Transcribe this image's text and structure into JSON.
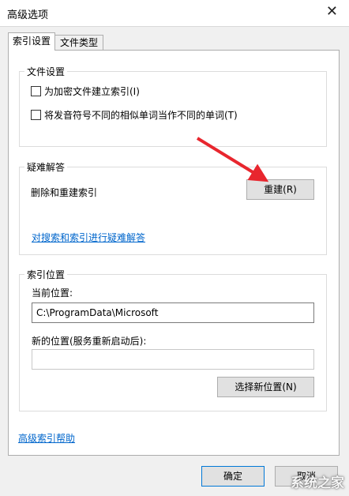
{
  "window": {
    "title": "高级选项",
    "close_glyph": "✕"
  },
  "tabs": [
    {
      "label": "索引设置",
      "active": true
    },
    {
      "label": "文件类型",
      "active": false
    }
  ],
  "file_settings": {
    "title": "文件设置",
    "options": [
      {
        "label": "为加密文件建立索引(I)",
        "checked": false
      },
      {
        "label": "将发音符号不同的相似单词当作不同的单词(T)",
        "checked": false
      }
    ]
  },
  "troubleshooting": {
    "title": "疑难解答",
    "rebuild_label": "删除和重建索引",
    "rebuild_button": "重建(R)",
    "link": "对搜索和索引进行疑难解答"
  },
  "index_location": {
    "title": "索引位置",
    "current_label": "当前位置:",
    "current_value": "C:\\ProgramData\\Microsoft",
    "new_label": "新的位置(服务重新启动后):",
    "new_value": "",
    "select_button": "选择新位置(N)"
  },
  "footer": {
    "help_link": "高级索引帮助",
    "ok_button": "确定",
    "cancel_button": "取消"
  },
  "watermark": "系统之家",
  "colors": {
    "link": "#0066cc",
    "arrow": "#e8262e",
    "button_bg": "#e1e1e1"
  }
}
